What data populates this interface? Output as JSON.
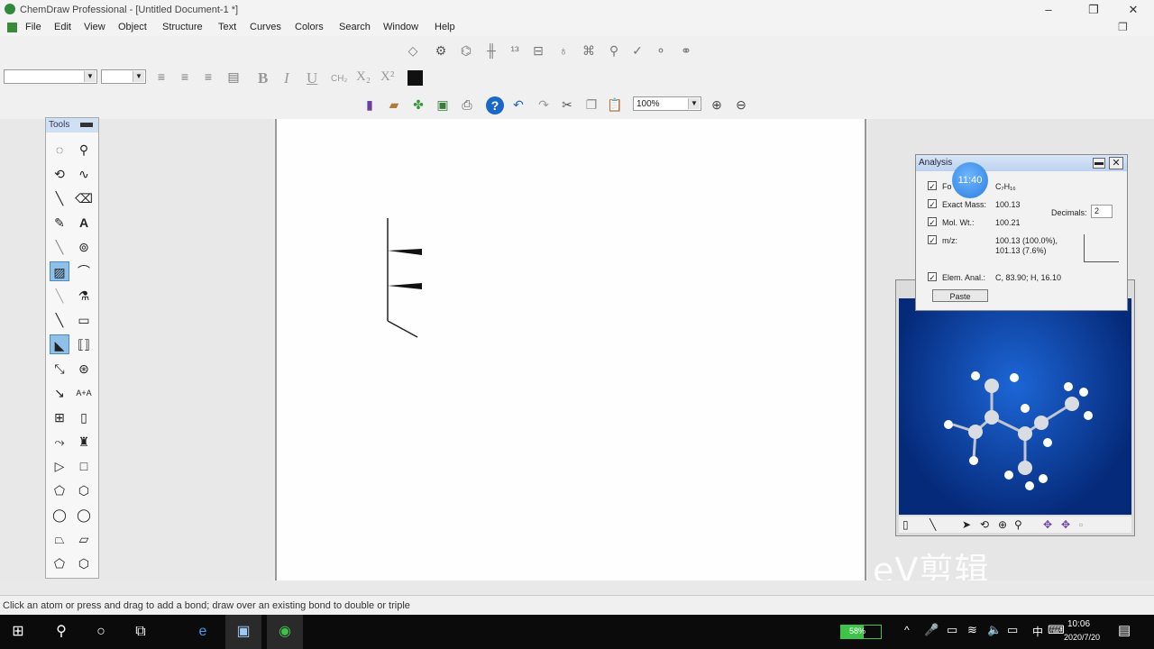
{
  "window": {
    "title": "ChemDraw Professional - [Untitled Document-1 *]",
    "minimize": "–",
    "maximize": "❐",
    "close": "✕"
  },
  "menu": [
    "File",
    "Edit",
    "View",
    "Object",
    "Structure",
    "Text",
    "Curves",
    "Colors",
    "Search",
    "Window",
    "Help"
  ],
  "toolbar": {
    "zoom_value": "100%",
    "bold": "B",
    "italic": "I",
    "underline": "U",
    "subscript": "X₂",
    "superscript": "X²"
  },
  "tools_palette": {
    "title": "Tools"
  },
  "analysis": {
    "title": "Analysis",
    "rows": [
      {
        "label": "Fo",
        "value": "C₇H₁₆"
      },
      {
        "label": "Exact Mass:",
        "value": "100.13"
      },
      {
        "label": "Mol. Wt.:",
        "value": "100.21"
      },
      {
        "label": "m/z:",
        "value": "100.13 (100.0%), 101.13 (7.6%)"
      },
      {
        "label": "Elem. Anal.:",
        "value": "C, 83.90; H, 16.10"
      }
    ],
    "decimals_label": "Decimals:",
    "decimals_value": "2",
    "paste_button": "Paste"
  },
  "clock_badge": "11:40",
  "status_bar": "Click an atom or press and drag to add a bond; draw over an existing bond to double or triple",
  "watermark": "eV剪辑",
  "taskbar": {
    "battery": "58%",
    "time": "10:06",
    "date": "2020/7/20",
    "ime": "中"
  },
  "colors": {
    "accent": "#2b7de0",
    "viewer_bg": "#0b3fa8",
    "taskbar": "#0b0b0b"
  }
}
